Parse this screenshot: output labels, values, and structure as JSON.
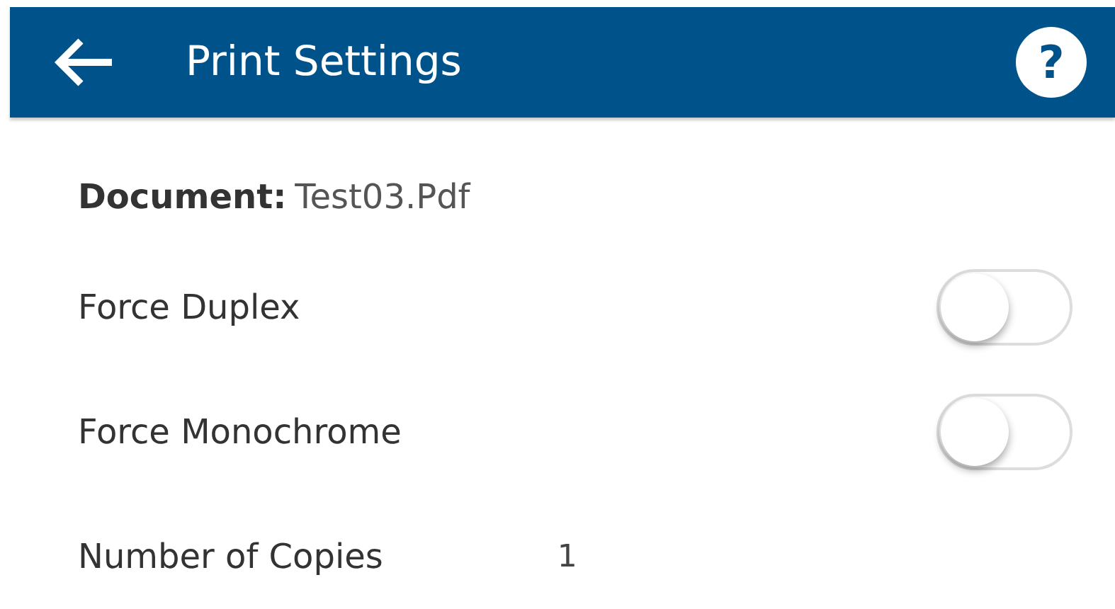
{
  "header": {
    "title": "Print Settings",
    "help": "?"
  },
  "document": {
    "label": "Document:",
    "value": "Test03.Pdf"
  },
  "settings": [
    {
      "kind": "toggle",
      "label": "Force Duplex",
      "on": false
    },
    {
      "kind": "toggle",
      "label": "Force Monochrome",
      "on": false
    },
    {
      "kind": "value",
      "label": "Number of Copies",
      "value": "1"
    }
  ]
}
